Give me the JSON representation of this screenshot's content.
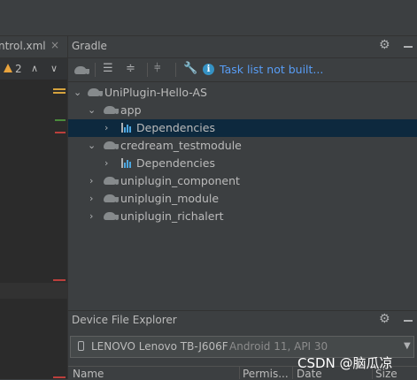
{
  "editor": {
    "tab_label": "ntrol.xml",
    "tab_close": "×",
    "warning_count": "2",
    "nav_up": "∧",
    "nav_down": "∨"
  },
  "gradle": {
    "title": "Gradle",
    "toolbar": {
      "info_text": "Task list not built...",
      "info_icon": "i"
    },
    "tree": [
      {
        "label": "UniPlugin-Hello-AS",
        "icon": "gradle-elephant-icon",
        "expanded": true
      },
      {
        "label": "app",
        "icon": "gradle-elephant-icon",
        "expanded": true
      },
      {
        "label": "Dependencies",
        "icon": "dependencies-icon",
        "expanded": false,
        "selected": true
      },
      {
        "label": "credream_testmodule",
        "icon": "gradle-elephant-icon",
        "expanded": true
      },
      {
        "label": "Dependencies",
        "icon": "dependencies-icon",
        "expanded": false
      },
      {
        "label": "uniplugin_component",
        "icon": "gradle-elephant-icon",
        "expanded": false
      },
      {
        "label": "uniplugin_module",
        "icon": "gradle-elephant-icon",
        "expanded": false
      },
      {
        "label": "uniplugin_richalert",
        "icon": "gradle-elephant-icon",
        "expanded": false
      }
    ]
  },
  "device_explorer": {
    "title": "Device File Explorer",
    "device_name": "LENOVO Lenovo TB-J606F",
    "device_detail": "Android 11, API 30",
    "columns": [
      "Name",
      "Permis...",
      "Date",
      "Size"
    ]
  },
  "watermark": "CSDN @脑瓜凉",
  "colors": {
    "accent_link": "#589df6",
    "selection": "#0d293e",
    "warning": "#e8a33d"
  }
}
